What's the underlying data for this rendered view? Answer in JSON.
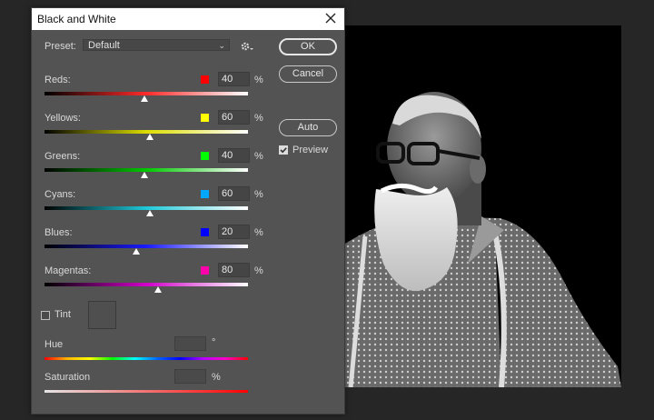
{
  "dialog": {
    "title": "Black and White",
    "preset_label": "Preset:",
    "preset_value": "Default",
    "buttons": {
      "ok": "OK",
      "cancel": "Cancel",
      "auto": "Auto"
    },
    "preview_label": "Preview",
    "preview_checked": true
  },
  "sliders": [
    {
      "label": "Reds:",
      "value": "40",
      "unit": "%",
      "color": "#ff0000",
      "level": 0.49,
      "gradient": [
        "#000000",
        "#ff2a2a",
        "#ffffff"
      ]
    },
    {
      "label": "Yellows:",
      "value": "60",
      "unit": "%",
      "color": "#ffff00",
      "level": 0.52,
      "gradient": [
        "#000000",
        "#dddd00",
        "#ffffff"
      ]
    },
    {
      "label": "Greens:",
      "value": "40",
      "unit": "%",
      "color": "#00ff00",
      "level": 0.49,
      "gradient": [
        "#000000",
        "#00c800",
        "#ffffff"
      ]
    },
    {
      "label": "Cyans:",
      "value": "60",
      "unit": "%",
      "color": "#00a6ff",
      "level": 0.52,
      "gradient": [
        "#000000",
        "#1ec8d8",
        "#ffffff"
      ]
    },
    {
      "label": "Blues:",
      "value": "20",
      "unit": "%",
      "color": "#0000ff",
      "level": 0.45,
      "gradient": [
        "#000000",
        "#1a1aff",
        "#ffffff"
      ]
    },
    {
      "label": "Magentas:",
      "value": "80",
      "unit": "%",
      "color": "#ff00aa",
      "level": 0.56,
      "gradient": [
        "#000000",
        "#d000c8",
        "#ffffff"
      ]
    }
  ],
  "tint": {
    "label": "Tint",
    "checked": false
  },
  "hue": {
    "label": "Hue",
    "unit": "°"
  },
  "saturation": {
    "label": "Saturation",
    "unit": "%"
  }
}
